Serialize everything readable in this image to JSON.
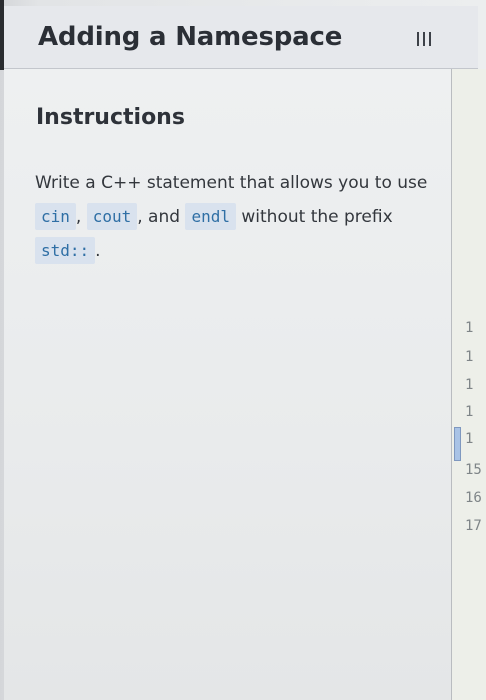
{
  "header": {
    "title": "Adding a Namespace",
    "menu_icon": "hamburger-menu-icon"
  },
  "instructions": {
    "heading": "Instructions",
    "text_before": "Write a C++ statement that allows you to use",
    "code_cin": "cin",
    "sep_comma": ",",
    "code_cout": "cout",
    "sep_and": ", and",
    "code_endl": "endl",
    "text_mid": "without the prefix",
    "code_std": "std::",
    "period": "."
  },
  "editor": {
    "line_numbers": [
      "1",
      "1",
      "1",
      "1",
      "1",
      "15",
      "16",
      "17"
    ]
  },
  "colors": {
    "code_text": "#2f6fa5",
    "code_background": "#d9e2ee",
    "header_background": "#e6e8ec"
  }
}
